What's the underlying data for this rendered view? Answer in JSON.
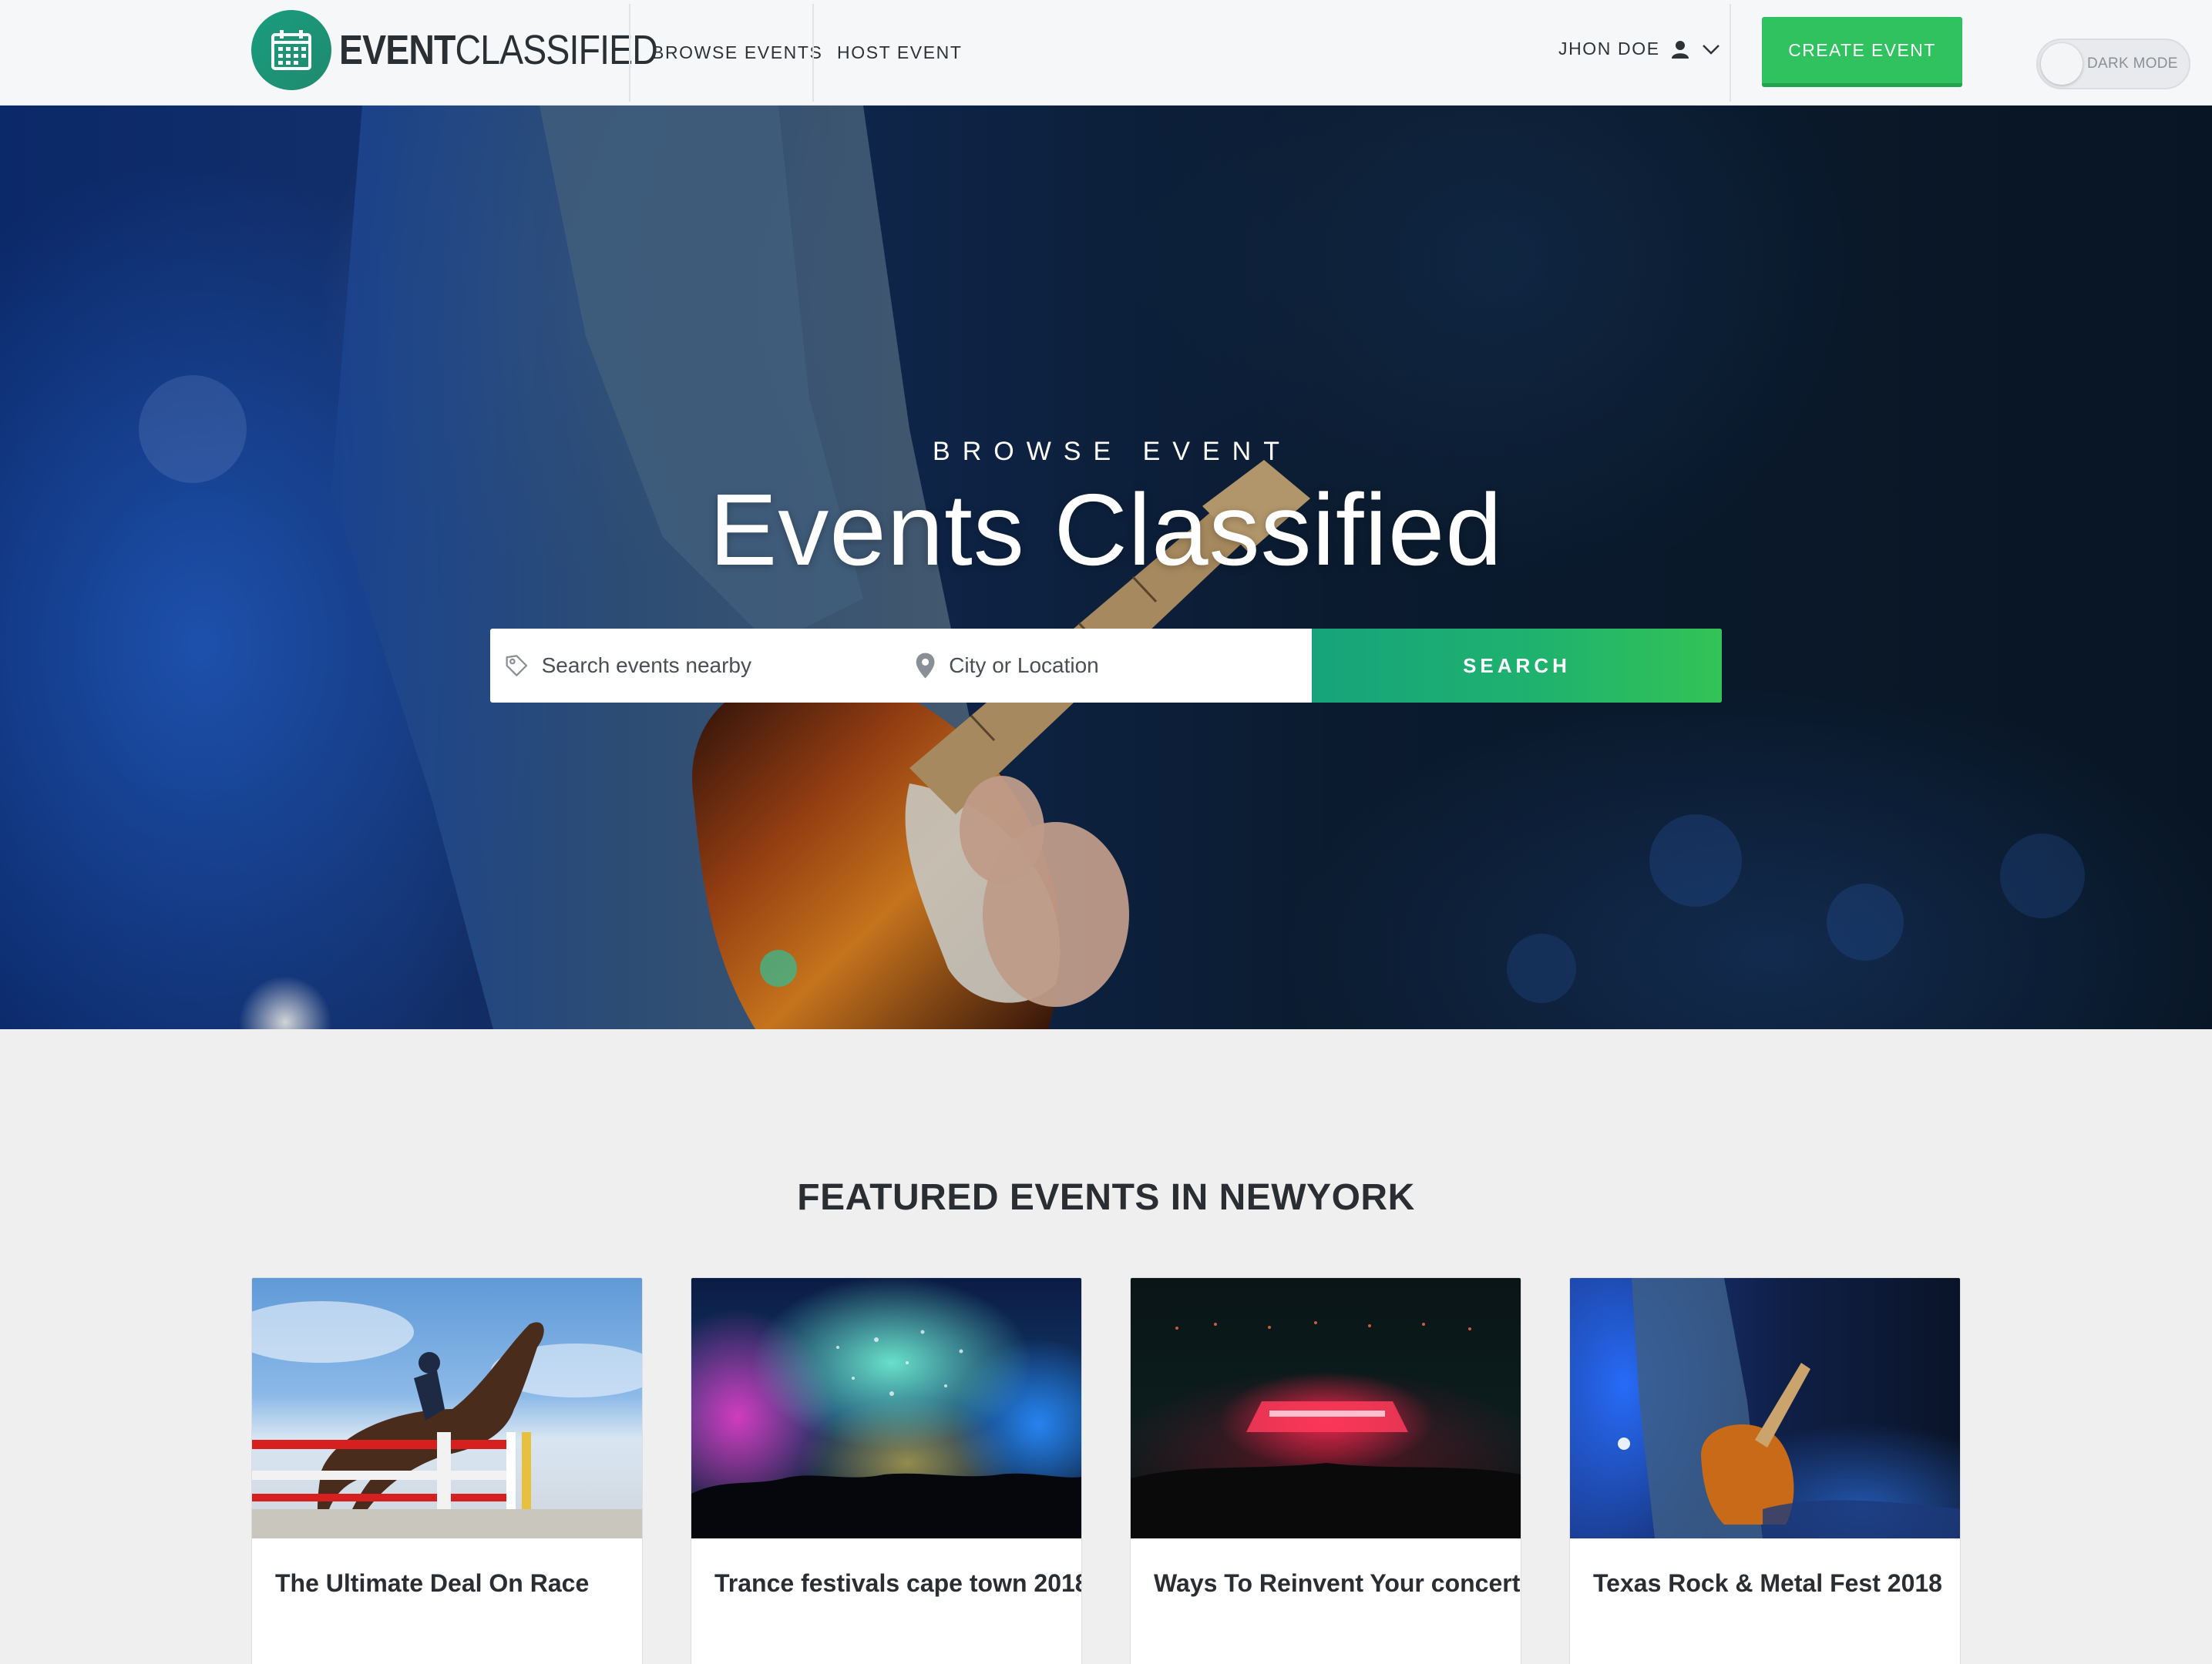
{
  "navbar": {
    "logo_bold": "EVENT",
    "logo_light": "CLASSIFIED",
    "links": [
      "BROWSE EVENTS",
      "HOST EVENT"
    ],
    "user_name": "JHON DOE",
    "create_label": "CREATE EVENT",
    "dark_mode_label": "DARK MODE"
  },
  "hero": {
    "eyebrow": "BROWSE EVENT",
    "title": "Events Classified",
    "search_placeholder": "Search events nearby",
    "location_placeholder": "City or Location",
    "search_button": "SEARCH"
  },
  "featured": {
    "heading": "FEATURED EVENTS IN NEWYORK",
    "cards": [
      {
        "title": "The Ultimate Deal On Race"
      },
      {
        "title": "Trance festivals cape town 2018"
      },
      {
        "title": "Ways To Reinvent Your concert"
      },
      {
        "title": "Texas Rock & Metal Fest 2018"
      }
    ]
  },
  "colors": {
    "accent_green": "#2fc25f",
    "brand_teal": "#1a9d7e",
    "search_gradient_start": "#16a37b",
    "search_gradient_end": "#33c356"
  },
  "icons": {
    "logo": "calendar-icon",
    "user": "user-icon",
    "dropdown": "chevron-down-icon",
    "search_field": "tag-icon",
    "location_field": "map-pin-icon"
  }
}
